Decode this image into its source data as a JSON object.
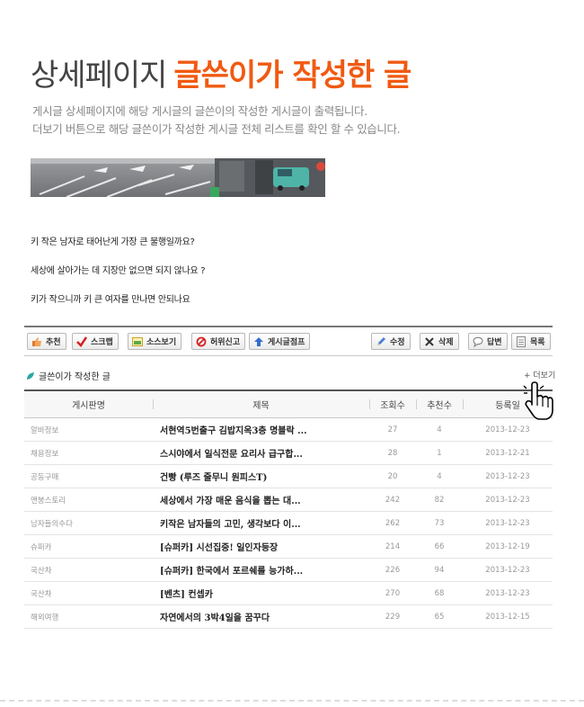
{
  "header": {
    "title_main": "상세페이지",
    "title_highlight": "글쓴이가 작성한 글",
    "desc_line1": "게시글 상세페이지에 해당 게시글의 글쓴이의 작성한 게시글이 출력됩니다.",
    "desc_line2": "더보기 버튼으로 해당 글쓴이가 작성한 게시글 전체 리스트를 확인 할 수 있습니다."
  },
  "post": {
    "lines": [
      "키 작은 남자로 태어난게 가장 큰 불행일까요?",
      "세상에 살아가는 데 지장만 없으면 되지 않나요 ?",
      "키가 작으니까 키 큰 여자를 만나면 안되나요"
    ]
  },
  "toolbar": {
    "left": [
      {
        "label": "추천",
        "icon": "thumbs-up-icon"
      },
      {
        "label": "스크랩",
        "icon": "check-icon"
      },
      {
        "label": "소스보기",
        "icon": "source-icon"
      },
      {
        "label": "허위신고",
        "icon": "prohibit-icon"
      },
      {
        "label": "게시글점프",
        "icon": "arrow-up-icon"
      }
    ],
    "right": [
      {
        "label": "수정",
        "icon": "pencil-icon"
      },
      {
        "label": "삭제",
        "icon": "x-icon"
      },
      {
        "label": "답변",
        "icon": "speech-bubble-icon"
      },
      {
        "label": "목록",
        "icon": "list-icon"
      }
    ]
  },
  "section": {
    "title": "글쓴이가 작성한 글",
    "more_label": "+ 더보기"
  },
  "table": {
    "headers": [
      "게시판명",
      "제목",
      "조회수",
      "추천수",
      "등록일"
    ],
    "rows": [
      {
        "board": "알바정보",
        "subject": "서현역5번출구 김밥지옥3층 명블락 ...",
        "views": "27",
        "recs": "4",
        "date": "2013-12-23"
      },
      {
        "board": "채용정보",
        "subject": "스시야에서 일식전문 요리사 급구합...",
        "views": "28",
        "recs": "1",
        "date": "2013-12-21"
      },
      {
        "board": "공동구매",
        "subject": "건빵 (루즈 줄무니 원피스T)",
        "views": "20",
        "recs": "4",
        "date": "2013-12-23"
      },
      {
        "board": "맨붕스토리",
        "subject": "세상에서 가장 매운 음식을 뽑는 대...",
        "views": "242",
        "recs": "82",
        "date": "2013-12-23"
      },
      {
        "board": "남자들의수다",
        "subject": "키작은 남자들의 고민, 생각보다 이...",
        "views": "262",
        "recs": "73",
        "date": "2013-12-23"
      },
      {
        "board": "슈퍼카",
        "subject": "[슈퍼카] 시선집중! 일인자등장",
        "views": "214",
        "recs": "66",
        "date": "2013-12-19"
      },
      {
        "board": "국산차",
        "subject": "[슈퍼카] 한국에서 포르쉐를 능가하...",
        "views": "226",
        "recs": "94",
        "date": "2013-12-23"
      },
      {
        "board": "국산차",
        "subject": "[벤츠] 컨셉카",
        "views": "270",
        "recs": "68",
        "date": "2013-12-23"
      },
      {
        "board": "해외여행",
        "subject": "자연에서의 3박4일을 꿈꾸다",
        "views": "229",
        "recs": "65",
        "date": "2013-12-15"
      }
    ]
  },
  "colors": {
    "accent": "#f05a12",
    "title": "#444444",
    "desc": "#888888"
  }
}
